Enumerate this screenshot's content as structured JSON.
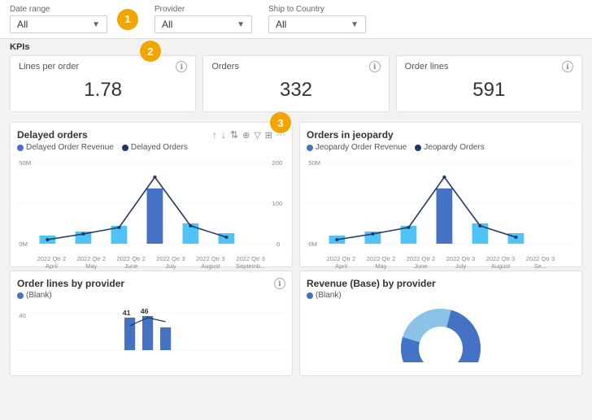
{
  "filters": {
    "dateRange": {
      "label": "Date range",
      "value": "All"
    },
    "provider": {
      "label": "Provider",
      "value": "All"
    },
    "shipToCountry": {
      "label": "Ship to Country",
      "value": "All"
    }
  },
  "badges": [
    "1",
    "2",
    "3"
  ],
  "kpis": {
    "section_label": "KPIs",
    "cards": [
      {
        "title": "Lines per order",
        "value": "1.78"
      },
      {
        "title": "Orders",
        "value": "332"
      },
      {
        "title": "Order lines",
        "value": "591"
      }
    ]
  },
  "charts": {
    "left": {
      "title": "Delayed orders",
      "legend": [
        {
          "color": "#4472c4",
          "label": "Delayed Order Revenue"
        },
        {
          "color": "#203864",
          "label": "Delayed Orders"
        }
      ],
      "yLeftLabels": [
        "50M",
        "0M"
      ],
      "yRightLabels": [
        "200",
        "100",
        "0"
      ],
      "xLabels": [
        {
          "line1": "2022 Qtr 2",
          "line2": "April"
        },
        {
          "line1": "2022 Qtr 2",
          "line2": "May"
        },
        {
          "line1": "2022 Qtr 2",
          "line2": "June"
        },
        {
          "line1": "2022 Qtr 3",
          "line2": "July"
        },
        {
          "line1": "2022 Qtr 3",
          "line2": "August"
        },
        {
          "line1": "2022 Qtr 3",
          "line2": "Septemb..."
        }
      ]
    },
    "right": {
      "title": "Orders in jeopardy",
      "legend": [
        {
          "color": "#4472c4",
          "label": "Jeopardy Order Revenue"
        },
        {
          "color": "#203864",
          "label": "Jeopardy Orders"
        }
      ],
      "yLeftLabels": [
        "50M",
        "0M"
      ],
      "xLabels": [
        {
          "line1": "2022 Qtr 2",
          "line2": "April"
        },
        {
          "line1": "2022 Qtr 2",
          "line2": "May"
        },
        {
          "line1": "2022 Qtr 2",
          "line2": "June"
        },
        {
          "line1": "2022 Qtr 3",
          "line2": "July"
        },
        {
          "line1": "2022 Qtr 3",
          "line2": "August"
        },
        {
          "line1": "2022 Qtr 3",
          "line2": "Se..."
        }
      ]
    }
  },
  "bottomCharts": {
    "left": {
      "title": "Order lines by provider",
      "legend": [
        {
          "color": "#4472c4",
          "label": "(Blank)"
        }
      ],
      "annotations": [
        "41",
        "46"
      ],
      "yLabel": "40"
    },
    "right": {
      "title": "Revenue (Base) by provider",
      "legend": [
        {
          "color": "#4472c4",
          "label": "(Blank)"
        }
      ]
    }
  },
  "toolbar": {
    "sortAsc": "↑",
    "sortDesc": "↓",
    "sort2": "↕",
    "hierarchy": "⋈",
    "filter": "▽",
    "expand": "⊞",
    "more": "..."
  }
}
